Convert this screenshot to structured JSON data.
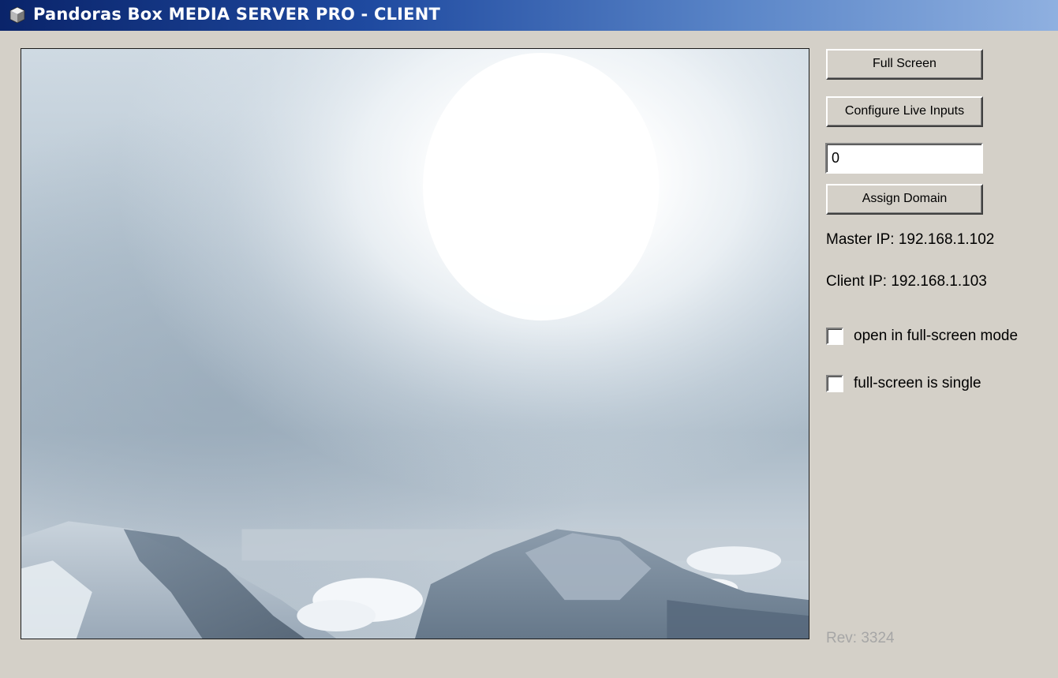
{
  "window": {
    "title": "Pandoras Box MEDIA SERVER PRO - CLIENT",
    "icon": "cube-icon"
  },
  "video": {
    "content": "mountain-clouds-sun-image"
  },
  "controls": {
    "full_screen_label": "Full Screen",
    "configure_live_inputs_label": "Configure Live Inputs",
    "domain_value": "0",
    "assign_domain_label": "Assign Domain"
  },
  "info": {
    "master_ip": "Master IP: 192.168.1.102",
    "client_ip": "Client IP: 192.168.1.103"
  },
  "options": [
    {
      "label": "open in full-screen mode",
      "checked": false
    },
    {
      "label": "full-screen is single",
      "checked": false
    }
  ],
  "revision": "Rev: 3324",
  "colors": {
    "window_bg": "#d4d0c8",
    "titlebar_start": "#0a246a",
    "titlebar_end": "#8fb0e0",
    "revision_text": "#a6a6a6"
  }
}
